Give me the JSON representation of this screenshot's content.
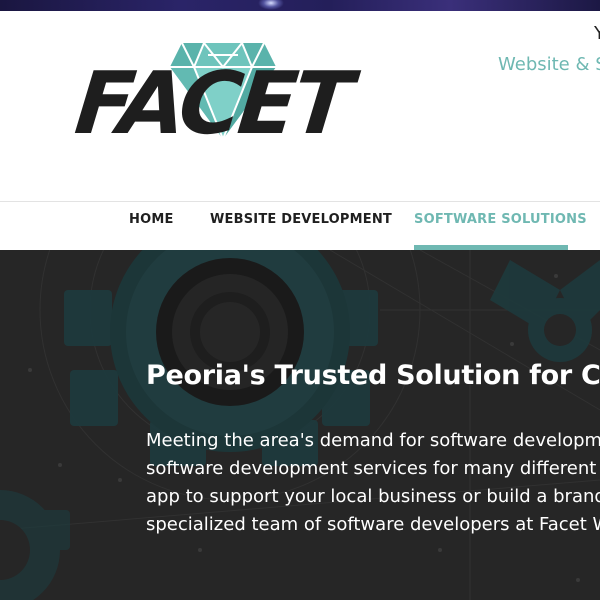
{
  "header": {
    "logo_text": "FACET",
    "tagline_line1": "Y",
    "tagline_line2": "Website & Sc"
  },
  "nav": {
    "items": [
      {
        "label": "HOME",
        "active": false
      },
      {
        "label": "WEBSITE DEVELOPMENT",
        "active": false
      },
      {
        "label": "SOFTWARE SOLUTIONS",
        "active": true
      }
    ]
  },
  "hero": {
    "title": "Peoria's Trusted Solution for Cus",
    "lines": [
      "Meeting the area's demand for software developm",
      "software development services for many different",
      "app to support your local business or build a brand",
      "specialized team of software developers at Facet W"
    ]
  },
  "colors": {
    "accent": "#6fb8b2",
    "nav_text": "#1f1f1f",
    "logo_text": "#1e1e1e",
    "hero_background": "#2b2b2b",
    "gear_teal": "#1f4a4e",
    "top_strip": "#241f5a"
  },
  "icons": {
    "logo_gem": "diamond-gem-icon",
    "hero_graphic": "gear-icon"
  }
}
